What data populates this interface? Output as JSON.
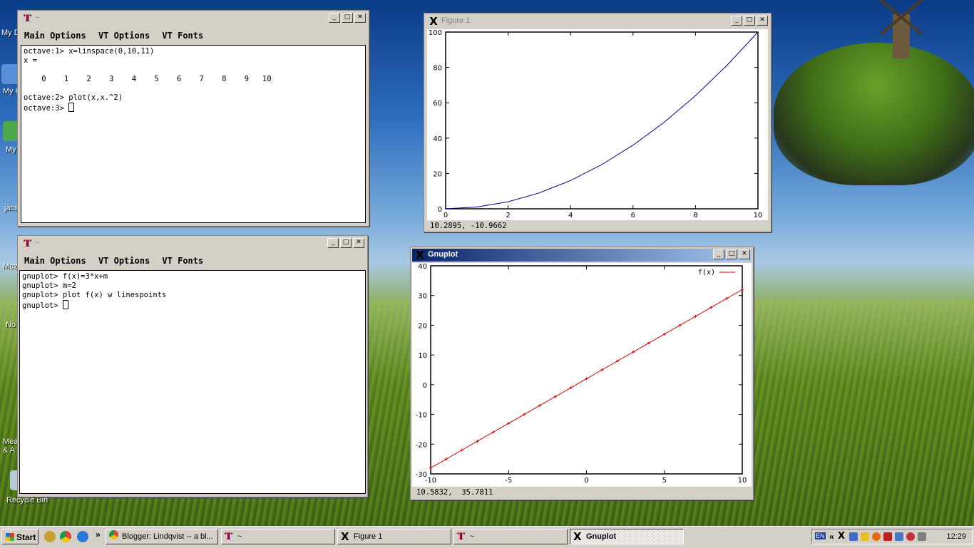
{
  "desktop": {
    "labels": [
      "My D",
      "My C",
      "My",
      "jacs",
      "Mozi",
      "No",
      "Mea",
      "& A",
      "Recycle Bin"
    ]
  },
  "octave_terminal": {
    "title": "~",
    "menu": [
      "Main Options",
      "VT Options",
      "VT Fonts"
    ],
    "lines": [
      "octave:1> x=linspace(0,10,11)",
      "x =",
      "",
      "    0    1    2    3    4    5    6    7    8    9   10",
      "",
      "octave:2> plot(x,x.^2)",
      "octave:3> "
    ]
  },
  "gnuplot_terminal": {
    "title": "~",
    "menu": [
      "Main Options",
      "VT Options",
      "VT Fonts"
    ],
    "lines": [
      "gnuplot> f(x)=3*x+m",
      "gnuplot> m=2",
      "gnuplot> plot f(x) w linespoints",
      "gnuplot> "
    ]
  },
  "figure1": {
    "title": "Figure 1",
    "status": "10.2895, -10.9662"
  },
  "gnuplot_window": {
    "title": "Gnuplot",
    "status": "10.5832,  35.7811"
  },
  "chart_data": [
    {
      "type": "line",
      "x": [
        0,
        1,
        2,
        3,
        4,
        5,
        6,
        7,
        8,
        9,
        10
      ],
      "series": [
        {
          "values": [
            0,
            1,
            4,
            9,
            16,
            25,
            36,
            49,
            64,
            81,
            100
          ],
          "color": "#00008b"
        }
      ],
      "xlim": [
        0,
        10
      ],
      "ylim": [
        0,
        100
      ],
      "xticks": [
        "0",
        "2",
        "4",
        "6",
        "8",
        "10"
      ],
      "yticks": [
        "0",
        "20",
        "40",
        "60",
        "80",
        "100"
      ],
      "grid": false
    },
    {
      "type": "line",
      "x": [
        -10,
        -9,
        -8,
        -7,
        -6,
        -5,
        -4,
        -3,
        -2,
        -1,
        0,
        1,
        2,
        3,
        4,
        5,
        6,
        7,
        8,
        9,
        10
      ],
      "series": [
        {
          "name": "f(x)",
          "values": [
            -28,
            -25,
            -22,
            -19,
            -16,
            -13,
            -10,
            -7,
            -4,
            -1,
            2,
            5,
            8,
            11,
            14,
            17,
            20,
            23,
            26,
            29,
            32
          ],
          "color": "#e00000"
        }
      ],
      "xlim": [
        -10,
        10
      ],
      "ylim": [
        -30,
        40
      ],
      "xticks": [
        "-10",
        "-5",
        "0",
        "5",
        "10"
      ],
      "yticks": [
        "-30",
        "-20",
        "-10",
        "0",
        "10",
        "20",
        "30",
        "40"
      ],
      "legend": "top-right",
      "grid": false
    }
  ],
  "taskbar": {
    "start_label": "Start",
    "chevron": "»",
    "tasks": [
      {
        "label": "Blogger: Lindqvist -- a bl...",
        "icon": "chrome-icon"
      },
      {
        "label": "~",
        "icon": "terminal-icon"
      },
      {
        "label": "Figure 1",
        "icon": "x-icon"
      },
      {
        "label": "~",
        "icon": "terminal-icon"
      },
      {
        "label": "Gnuplot",
        "icon": "x-icon",
        "active": true
      }
    ],
    "tray": {
      "lang": "EN",
      "chevron": "«",
      "clock": "12:29"
    }
  }
}
